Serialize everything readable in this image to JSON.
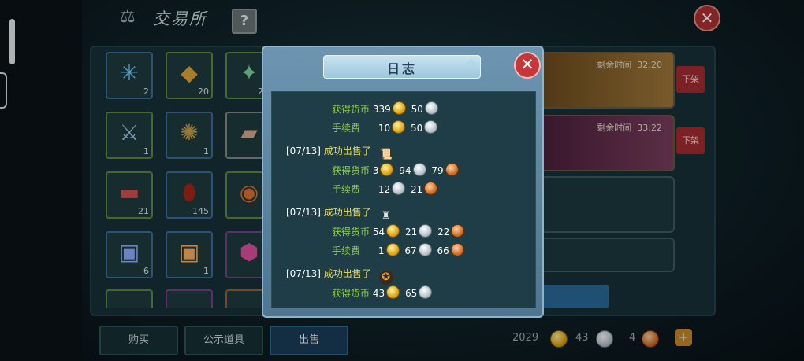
{
  "header": {
    "title": "交易所",
    "help_label": "?"
  },
  "inventory": {
    "counts": [
      "2",
      "20",
      "25",
      "1",
      "1",
      "21",
      "145",
      "9",
      "6",
      "1"
    ]
  },
  "listings": [
    {
      "time_label": "剩余时间",
      "time_value": "32:20",
      "delist_label": "下架"
    },
    {
      "time_label": "剩余时间",
      "time_value": "33:22",
      "delist_label": "下架"
    }
  ],
  "bottom": {
    "buy_label": "购买",
    "showcase_label": "公示道具",
    "sell_label": "出售",
    "gold": "2029",
    "silver": "43",
    "copper": "4"
  },
  "dialog": {
    "title": "日志",
    "entries": [
      {
        "date": "",
        "sold_label": "",
        "item_name": "",
        "earned_label": "获得货币",
        "earned": {
          "gold": "339",
          "silver": "50",
          "copper": ""
        },
        "fee_label": "手续费",
        "fee": {
          "gold": "10",
          "silver": "50",
          "copper": ""
        }
      },
      {
        "date": "[07/13]",
        "sold_label": "成功出售了",
        "item_name": "",
        "earned_label": "获得货币",
        "earned": {
          "gold": "3",
          "silver": "94",
          "copper": "79"
        },
        "fee_label": "手续费",
        "fee": {
          "gold": "",
          "silver": "12",
          "copper": "21"
        }
      },
      {
        "date": "[07/13]",
        "sold_label": "成功出售了",
        "item_name": "",
        "earned_label": "获得货币",
        "earned": {
          "gold": "54",
          "silver": "21",
          "copper": "22"
        },
        "fee_label": "手续费",
        "fee": {
          "gold": "1",
          "silver": "67",
          "copper": "66"
        }
      },
      {
        "date": "[07/13]",
        "sold_label": "成功出售了",
        "item_name": "",
        "earned_label": "获得货币",
        "earned": {
          "gold": "43",
          "silver": "65",
          "copper": ""
        }
      }
    ]
  }
}
